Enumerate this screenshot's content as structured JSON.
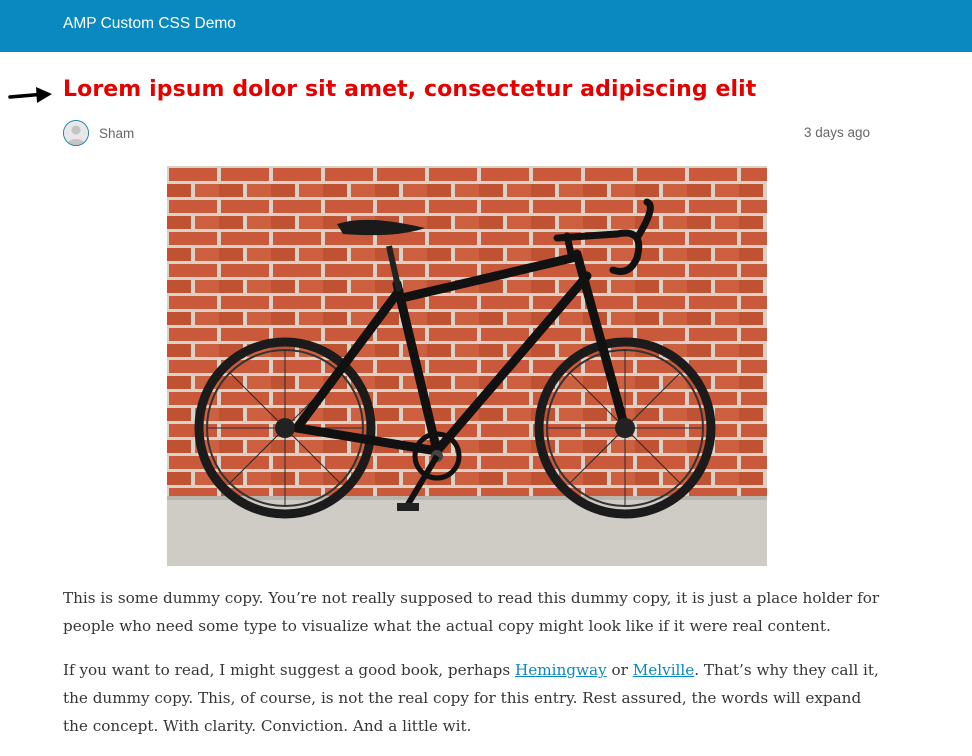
{
  "header": {
    "site_title": "AMP Custom CSS Demo",
    "background": "#0a89c0"
  },
  "post": {
    "title": "Lorem ipsum dolor sit amet, consectetur adipiscing elit",
    "title_color": "#e50000",
    "author": "Sham",
    "date": "3 days ago",
    "featured_image": "bicycle-against-brick-wall",
    "paragraph_1": "This is some dummy copy. You’re not really supposed to read this dummy copy, it is just a place holder for people who need some type to visualize what the actual copy might look like if it were real content.",
    "paragraph_2_before": "If you want to read, I might suggest a good book, perhaps ",
    "link_1": "Hemingway",
    "paragraph_2_between": " or ",
    "link_2": "Melville",
    "paragraph_2_after": ". That’s why they call it, the dummy copy. This, of course, is not the real copy for this entry. Rest assured, the words will expand the concept. With clarity. Conviction. And a little wit."
  },
  "icons": {
    "annotation": "arrow-right-icon",
    "avatar": "user-silhouette-icon"
  }
}
